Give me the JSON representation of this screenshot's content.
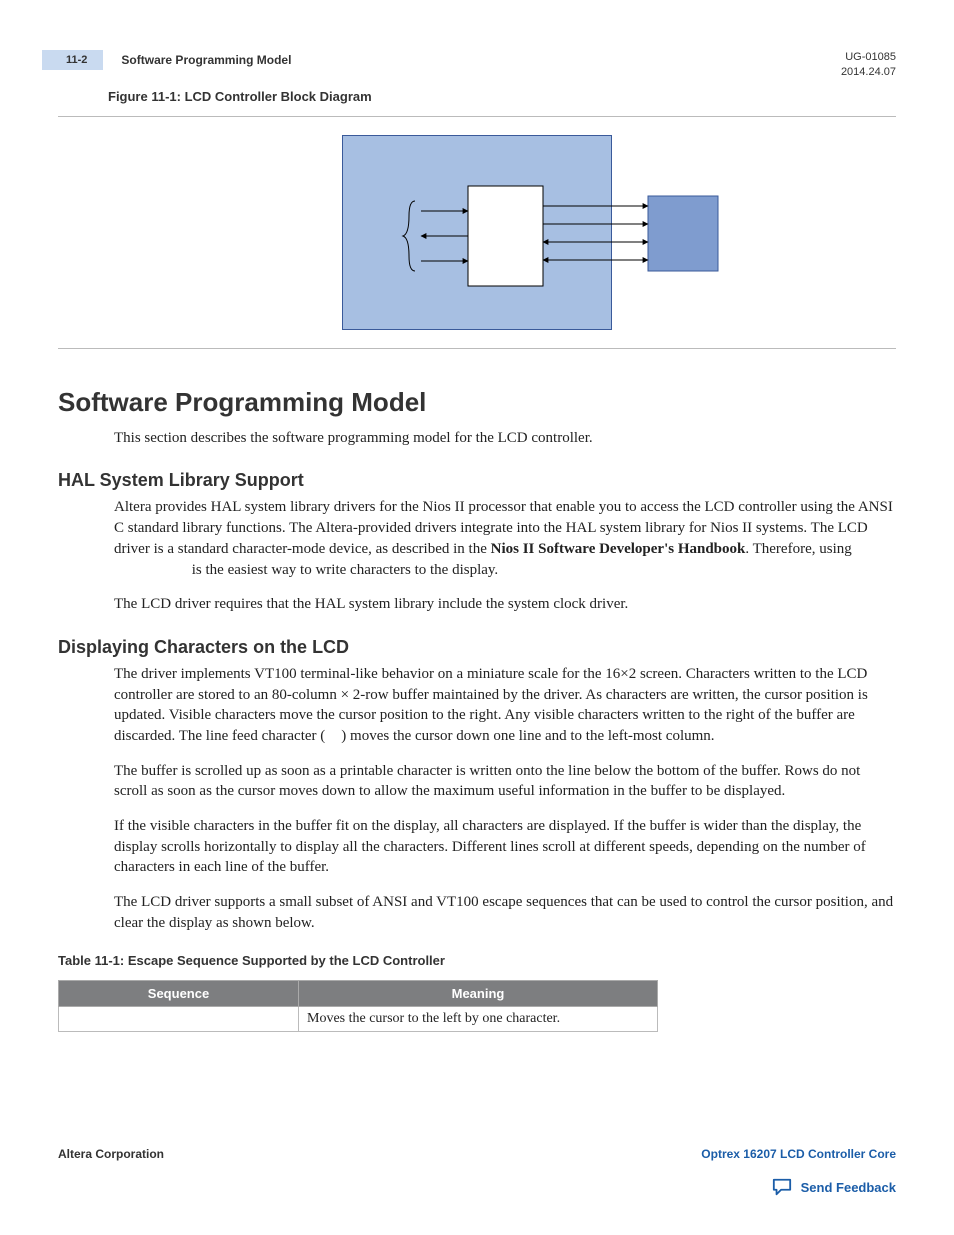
{
  "header": {
    "page_tag": "11-2",
    "title": "Software Programming Model",
    "doc_id": "UG-01085",
    "date": "2014.24.07"
  },
  "figure": {
    "caption": "Figure 11-1: LCD Controller Block Diagram"
  },
  "sections": {
    "major_h": "Software Programming Model",
    "intro": "This section describes the software programming model for the LCD controller.",
    "hal": {
      "h": "HAL System Library Support",
      "p1_a": "Altera provides HAL system library drivers for the Nios II processor that enable you to access the LCD controller using the ANSI C standard library functions. The Altera-provided drivers integrate into the HAL system library for Nios II systems. The LCD driver is a standard character-mode device, as described in the ",
      "p1_bold": "Nios II Software Developer's Handbook",
      "p1_b": ". Therefore, using ",
      "p1_code": "",
      "p1_c": " is the easiest way to write characters to the display.",
      "p2": "The LCD driver requires that the HAL system library include the system clock driver."
    },
    "disp": {
      "h": "Displaying Characters on the LCD",
      "p1_a": "The driver implements VT100 terminal-like behavior on a miniature scale for the 16×2 screen. Characters written to the LCD controller are stored to an 80-column × 2-row buffer maintained by the driver. As characters are written, the cursor position is updated. Visible characters move the cursor position to the right. Any visible characters written to the right of the buffer are discarded. The line feed character (",
      "p1_code": "",
      "p1_b": ") moves the cursor down one line and to the left-most column.",
      "p2": "The buffer is scrolled up as soon as a printable character is written onto the line below the bottom of the buffer. Rows do not scroll as soon as the cursor moves down to allow the maximum useful information in the buffer to be displayed.",
      "p3": "If the visible characters in the buffer fit on the display, all characters are displayed. If the buffer is wider than the display, the display scrolls horizontally to display all the characters. Different lines scroll at different speeds, depending on the number of characters in each line of the buffer.",
      "p4": "The LCD driver supports a small subset of ANSI and VT100 escape sequences that can be used to control the cursor position, and clear the display as shown below."
    }
  },
  "table": {
    "caption": "Table 11-1: Escape Sequence Supported by the LCD Controller",
    "headers": {
      "col1": "Sequence",
      "col2": "Meaning"
    },
    "rows": [
      {
        "sequence": "",
        "meaning": "Moves the cursor to the left by one character."
      }
    ]
  },
  "footer": {
    "left": "Altera Corporation",
    "right": "Optrex 16207 LCD Controller Core",
    "feedback": "Send Feedback"
  },
  "chart_data": {
    "type": "diagram",
    "title": "LCD Controller Block Diagram",
    "blocks": [
      {
        "id": "core",
        "shape": "rect",
        "fill": "white",
        "position": "center"
      },
      {
        "id": "ext",
        "shape": "rect",
        "fill": "blue",
        "position": "right"
      }
    ],
    "arrows_left_to_core": [
      {
        "dir": "into_core"
      },
      {
        "dir": "out_of_core"
      },
      {
        "dir": "into_core"
      }
    ],
    "arrows_core_to_ext": [
      {
        "dir": "to_ext"
      },
      {
        "dir": "to_ext"
      },
      {
        "dir": "bidir"
      },
      {
        "dir": "bidir"
      }
    ],
    "left_group_brace": true
  }
}
